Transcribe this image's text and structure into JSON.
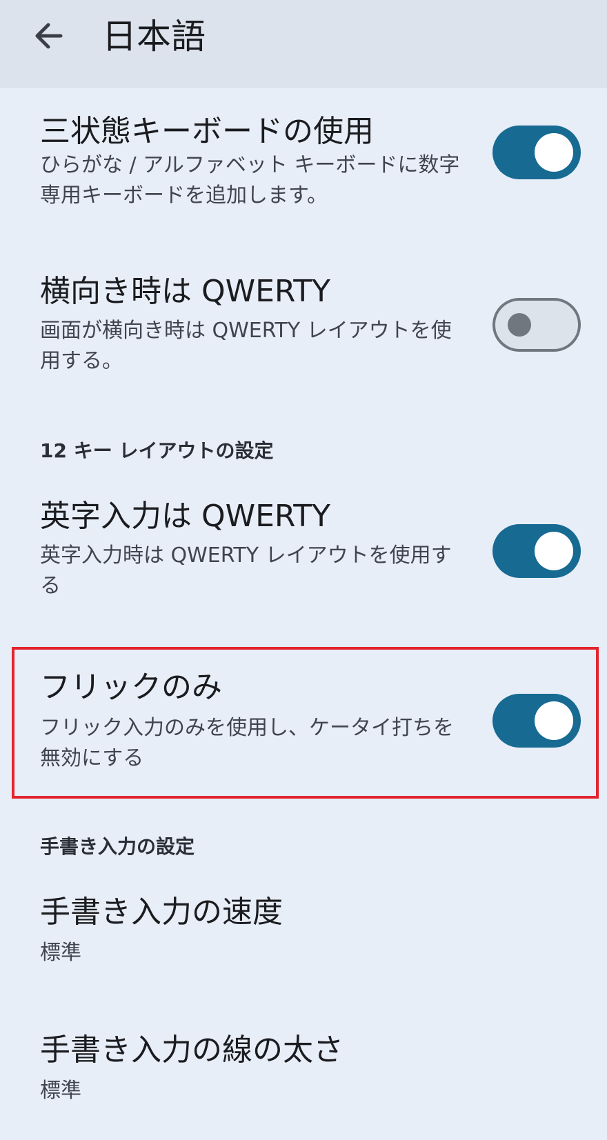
{
  "appbar": {
    "title": "日本語",
    "back_icon": "arrow-left-icon"
  },
  "settings": {
    "three_state_keyboard": {
      "title": "三状態キーボードの使用",
      "summary": "ひらがな / アルファベット キーボードに数字専用キーボードを追加します。",
      "enabled": true
    },
    "landscape_qwerty": {
      "title": "横向き時は QWERTY",
      "summary": "画面が横向き時は QWERTY レイアウトを使用する。",
      "enabled": false
    },
    "section_12key": "12 キー レイアウトの設定",
    "alpha_qwerty": {
      "title": "英字入力は QWERTY",
      "summary": "英字入力時は QWERTY レイアウトを使用する",
      "enabled": true
    },
    "flick_only": {
      "title": "フリックのみ",
      "summary": "フリック入力のみを使用し、ケータイ打ちを無効にする",
      "enabled": true
    },
    "section_handwriting": "手書き入力の設定",
    "handwriting_speed": {
      "title": "手書き入力の速度",
      "summary": "標準"
    },
    "handwriting_stroke": {
      "title": "手書き入力の線の太さ",
      "summary": "標準"
    }
  },
  "colors": {
    "accent": "#176a92",
    "highlight_border": "#e2242e",
    "background": "#e8eef7",
    "appbar": "#dce3ec"
  }
}
